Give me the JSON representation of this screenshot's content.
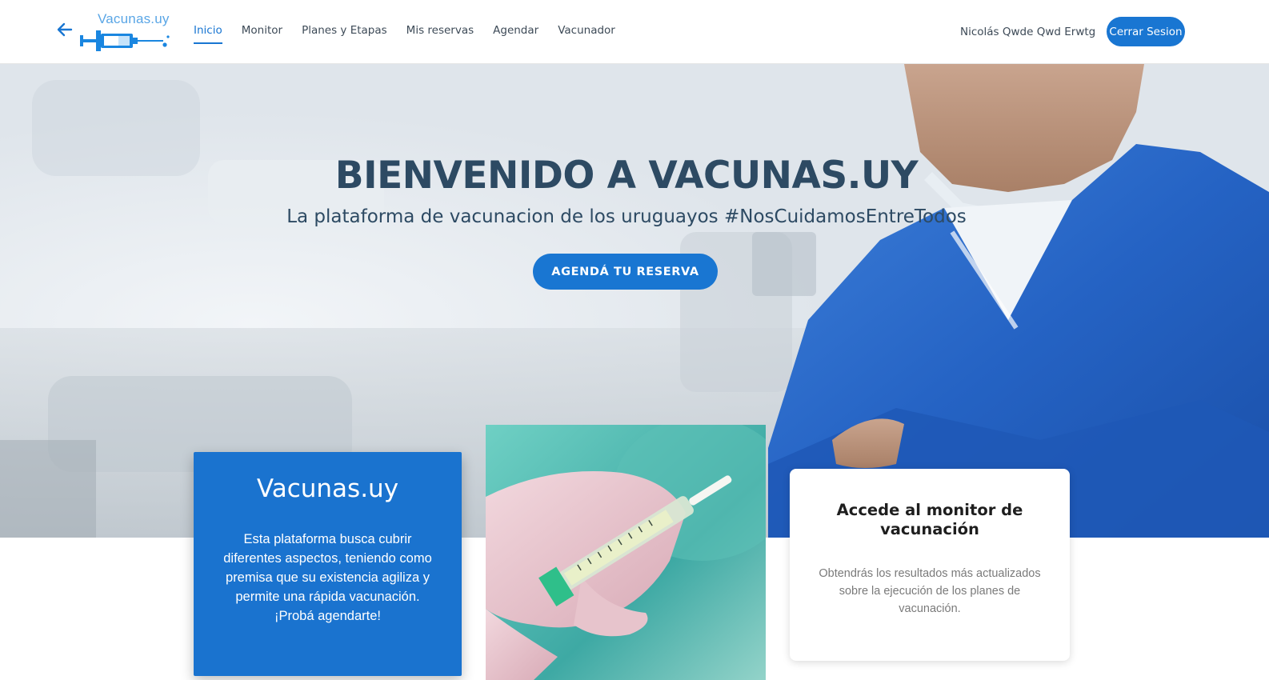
{
  "app": {
    "logo_text": "Vacunas.uy"
  },
  "nav": {
    "items": [
      {
        "label": "Inicio",
        "active": true
      },
      {
        "label": "Monitor",
        "active": false
      },
      {
        "label": "Planes y Etapas",
        "active": false
      },
      {
        "label": "Mis reservas",
        "active": false
      },
      {
        "label": "Agendar",
        "active": false
      },
      {
        "label": "Vacunador",
        "active": false
      }
    ],
    "user_name": "Nicolás Qwde Qwd Erwtg",
    "logout_label": "Cerrar Sesion"
  },
  "hero": {
    "title": "BIENVENIDO A VACUNAS.UY",
    "subtitle": "La plataforma de vacunacion de los uruguayos #NosCuidamosEntreTodos",
    "cta_label": "AGENDÁ TU RESERVA"
  },
  "card_about": {
    "title": "Vacunas.uy",
    "text": "Esta plataforma busca cubrir diferentes aspectos, teniendo como premisa que su existencia agiliza y permite una rápida vacunación. ¡Probá agendarte!"
  },
  "card_monitor": {
    "title": "Accede al monitor de vacunación",
    "text": "Obtendrás los resultados más actualizados sobre la ejecución de los planes de vacunación."
  },
  "colors": {
    "primary": "#1976d2",
    "hero_text": "#2d4a63",
    "scrubs_blue": "#2563c4"
  },
  "icons": {
    "back": "arrow-left-icon",
    "logo": "syringe-logo"
  }
}
